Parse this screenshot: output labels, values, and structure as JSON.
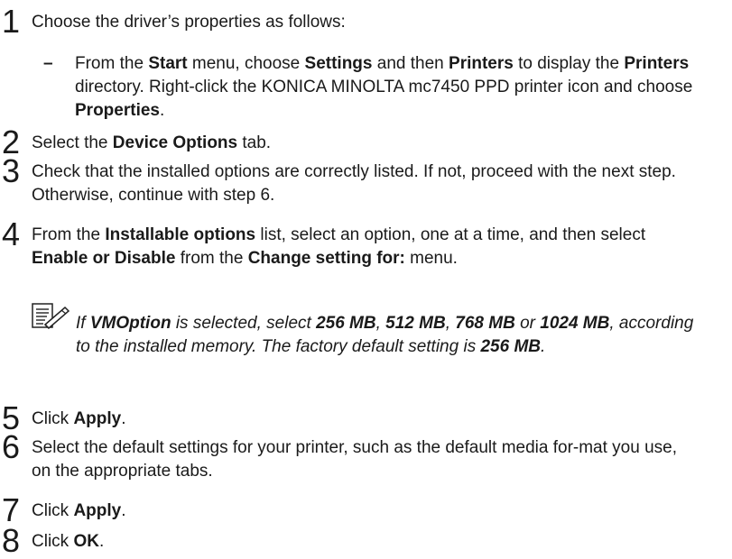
{
  "steps": [
    {
      "number": "1",
      "segments": [
        {
          "t": "Choose the driver’s properties as follows:"
        }
      ]
    },
    {
      "number": "2",
      "segments": [
        {
          "t": "Select the "
        },
        {
          "t": "Device Options",
          "b": true
        },
        {
          "t": " tab."
        }
      ]
    },
    {
      "number": "3",
      "segments": [
        {
          "t": "Check that the installed options are correctly listed. If not, proceed with the next step. Otherwise, continue with step 6."
        }
      ]
    },
    {
      "number": "4",
      "segments": [
        {
          "t": "From the "
        },
        {
          "t": "Installable options",
          "b": true
        },
        {
          "t": " list, select an option, one at a time, and then select "
        },
        {
          "t": "Enable or Disable",
          "b": true
        },
        {
          "t": " from the "
        },
        {
          "t": "Change setting for:",
          "b": true
        },
        {
          "t": " menu."
        }
      ]
    },
    {
      "number": "5",
      "segments": [
        {
          "t": "Click "
        },
        {
          "t": "Apply",
          "b": true
        },
        {
          "t": "."
        }
      ]
    },
    {
      "number": "6",
      "segments": [
        {
          "t": "Select the default settings for your printer, such as the default media for-mat you use, on the appropriate tabs."
        }
      ]
    },
    {
      "number": "7",
      "segments": [
        {
          "t": "Click "
        },
        {
          "t": "Apply",
          "b": true
        },
        {
          "t": "."
        }
      ]
    },
    {
      "number": "8",
      "segments": [
        {
          "t": "Click "
        },
        {
          "t": "OK",
          "b": true
        },
        {
          "t": "."
        }
      ]
    }
  ],
  "substep": {
    "dash": "–",
    "segments": [
      {
        "t": "From the "
      },
      {
        "t": "Start",
        "b": true
      },
      {
        "t": " menu, choose "
      },
      {
        "t": "Settings",
        "b": true
      },
      {
        "t": " and then "
      },
      {
        "t": "Printers",
        "b": true
      },
      {
        "t": " to display the "
      },
      {
        "t": "Printers",
        "b": true
      },
      {
        "t": " directory. Right-click the KONICA MINOLTA mc7450 PPD printer icon and choose "
      },
      {
        "t": "Properties",
        "b": true
      },
      {
        "t": "."
      }
    ]
  },
  "note": {
    "icon": "note-pencil-icon",
    "segments": [
      {
        "t": "If "
      },
      {
        "t": "VMOption",
        "b": true
      },
      {
        "t": " is selected, select "
      },
      {
        "t": "256 MB",
        "b": true
      },
      {
        "t": ", "
      },
      {
        "t": "512 MB",
        "b": true
      },
      {
        "t": ", "
      },
      {
        "t": "768 MB",
        "b": true
      },
      {
        "t": " or "
      },
      {
        "t": "1024 MB",
        "b": true
      },
      {
        "t": ", according to the installed memory. The factory default setting is "
      },
      {
        "t": "256 MB",
        "b": true
      },
      {
        "t": "."
      }
    ]
  }
}
